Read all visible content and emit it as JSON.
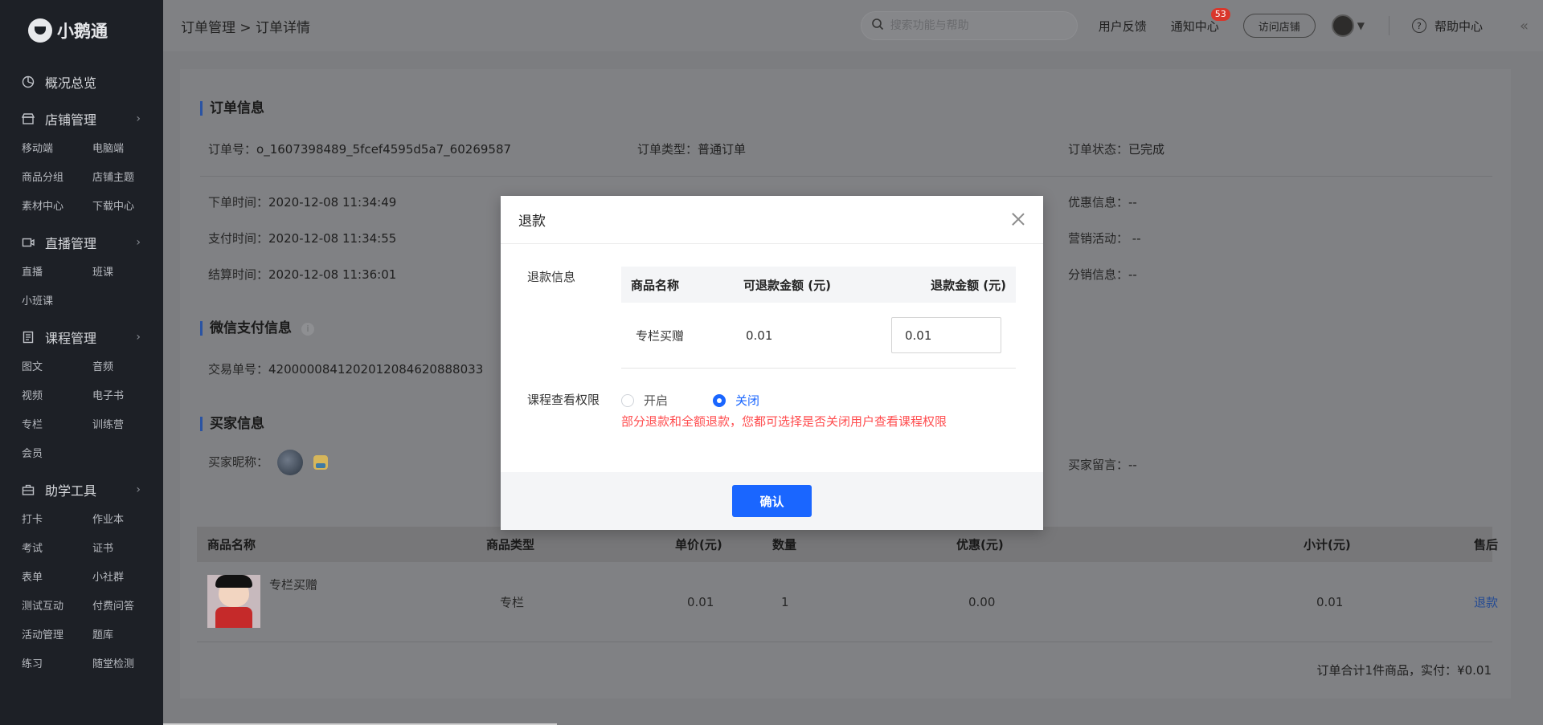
{
  "sidebar": {
    "logo": "小鹅通",
    "overview": "概况总览",
    "sections": [
      {
        "title": "店铺管理",
        "icon": "store-icon",
        "items": [
          "移动端",
          "电脑端",
          "商品分组",
          "店铺主题",
          "素材中心",
          "下载中心"
        ]
      },
      {
        "title": "直播管理",
        "icon": "live-icon",
        "items": [
          "直播",
          "班课",
          "小班课"
        ]
      },
      {
        "title": "课程管理",
        "icon": "course-icon",
        "items": [
          "图文",
          "音频",
          "视频",
          "电子书",
          "专栏",
          "训练营",
          "会员"
        ]
      },
      {
        "title": "助学工具",
        "icon": "toolbox-icon",
        "items": [
          "打卡",
          "作业本",
          "考试",
          "证书",
          "表单",
          "小社群",
          "测试互动",
          "付费问答",
          "活动管理",
          "题库",
          "练习",
          "随堂检测"
        ]
      }
    ]
  },
  "topbar": {
    "breadcrumb": "订单管理 > 订单详情",
    "search_placeholder": "搜索功能与帮助",
    "feedback": "用户反馈",
    "notifications": "通知中心",
    "notification_count": "53",
    "visit_store": "访问店铺",
    "help": "帮助中心"
  },
  "order": {
    "section_title": "订单信息",
    "order_no_label": "订单号：",
    "order_no": "o_1607398489_5fcef4595d5a7_60269587",
    "type_label": "订单类型：",
    "type": "普通订单",
    "status_label": "订单状态：",
    "status": "已完成",
    "created_label": "下单时间：",
    "created": "2020-12-08 11:34:49",
    "paid_label": "支付时间：",
    "paid": "2020-12-08 11:34:55",
    "settled_label": "结算时间：",
    "settled": "2020-12-08 11:36:01",
    "discount_label": "优惠信息：",
    "discount": "--",
    "marketing_label": "营销活动：",
    "marketing": " --",
    "distribution_label": "分销信息：",
    "distribution": "--"
  },
  "wechat": {
    "section_title": "微信支付信息",
    "txn_label": "交易单号：",
    "txn": "4200000841202012084620888033"
  },
  "buyer": {
    "section_title": "买家信息",
    "nickname_label": "买家昵称：",
    "message_label": "买家留言：",
    "message": "--"
  },
  "goods_table": {
    "headers": [
      "商品名称",
      "商品类型",
      "单价(元)",
      "数量",
      "优惠(元)",
      "小计(元)",
      "售后"
    ],
    "row": {
      "name": "专栏买赠",
      "type": "专栏",
      "price": "0.01",
      "qty": "1",
      "discount": "0.00",
      "subtotal": "0.01",
      "action": "退款"
    },
    "total": "订单合计1件商品，实付：¥0.01"
  },
  "modal": {
    "title": "退款",
    "refund_info_label": "退款信息",
    "headers": [
      "商品名称",
      "可退款金额 (元)",
      "退款金额 (元)"
    ],
    "row": {
      "name": "专栏买赠",
      "refundable": "0.01",
      "amount": "0.01"
    },
    "permission_label": "课程查看权限",
    "option_on": "开启",
    "option_off": "关闭",
    "selected": "关闭",
    "warning": "部分退款和全额退款，您都可选择是否关闭用户查看课程权限",
    "confirm": "确认"
  },
  "colors": {
    "primary": "#1a66ff",
    "warning": "#ff4d4f",
    "sidebar": "#1d2026"
  }
}
